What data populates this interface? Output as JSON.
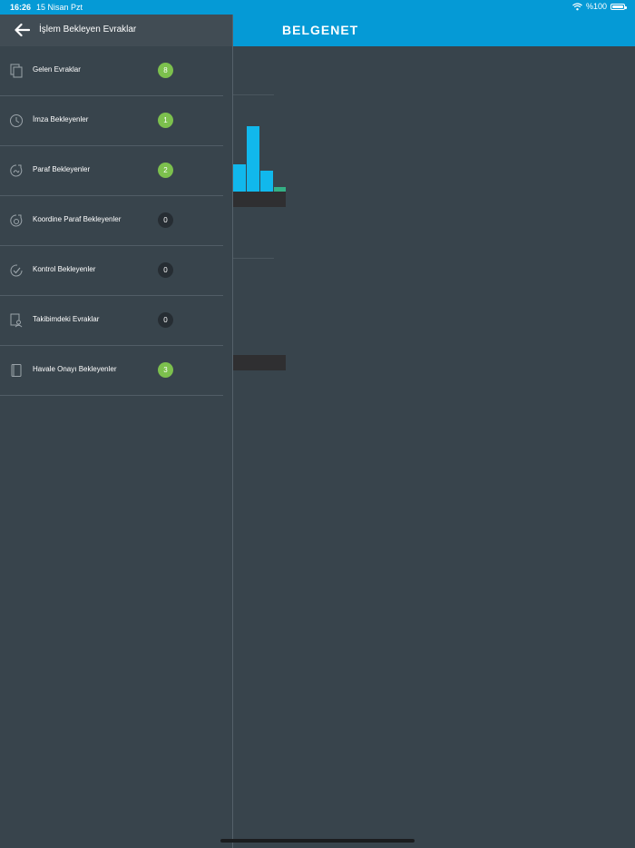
{
  "status_bar": {
    "time": "16:26",
    "date": "15 Nisan Pzt",
    "battery": "%100",
    "icons": [
      "wifi-icon",
      "battery-icon"
    ]
  },
  "app": {
    "title": "BELGENET",
    "accent_color": "#059ad6"
  },
  "drawer": {
    "title": "İşlem Bekleyen Evraklar",
    "back_icon": "arrow-left-icon",
    "items": [
      {
        "label": "Gelen Evraklar",
        "count": "8",
        "icon": "documents-icon",
        "badge_color": "#7cc04d"
      },
      {
        "label": "İmza Bekleyenler",
        "count": "1",
        "icon": "clock-icon",
        "badge_color": "#7cc04d"
      },
      {
        "label": "Paraf Bekleyenler",
        "count": "2",
        "icon": "paraf-icon",
        "badge_color": "#7cc04d"
      },
      {
        "label": "Koordine Paraf Bekleyenler",
        "count": "0",
        "icon": "coordinate-paraf-icon",
        "badge_color": "#262d33"
      },
      {
        "label": "Kontrol Bekleyenler",
        "count": "0",
        "icon": "check-circle-icon",
        "badge_color": "#262d33"
      },
      {
        "label": "Takibimdeki Evraklar",
        "count": "0",
        "icon": "tracking-icon",
        "badge_color": "#262d33"
      },
      {
        "label": "Havale Onayı Bekleyenler",
        "count": "3",
        "icon": "transfer-document-icon",
        "badge_color": "#7cc04d"
      }
    ]
  }
}
